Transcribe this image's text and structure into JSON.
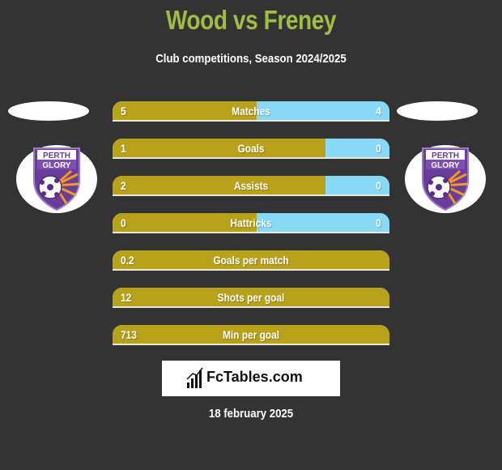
{
  "header": {
    "title": "Wood vs Freney",
    "subtitle": "Club competitions, Season 2024/2025"
  },
  "players": {
    "left": {
      "name": "Wood",
      "club_logo": "perth-glory-logo",
      "club_text": [
        "PERTH",
        "GLORY"
      ]
    },
    "right": {
      "name": "Freney",
      "club_logo": "perth-glory-logo",
      "club_text": [
        "PERTH",
        "GLORY"
      ]
    }
  },
  "colors": {
    "left": "#b8a21a",
    "right": "#87d9f5",
    "title": "#a0bc43",
    "background": "#333333"
  },
  "stats": [
    {
      "label": "Matches",
      "left": "5",
      "right": "4",
      "left_fill": 0.52
    },
    {
      "label": "Goals",
      "left": "1",
      "right": "0",
      "left_fill": 0.77
    },
    {
      "label": "Assists",
      "left": "2",
      "right": "0",
      "left_fill": 0.77
    },
    {
      "label": "Hattricks",
      "left": "0",
      "right": "0",
      "left_fill": 0.52
    },
    {
      "label": "Goals per match",
      "left": "0.2",
      "right": "",
      "left_fill": 1.0
    },
    {
      "label": "Shots per goal",
      "left": "12",
      "right": "",
      "left_fill": 1.0
    },
    {
      "label": "Min per goal",
      "left": "713",
      "right": "",
      "left_fill": 1.0
    }
  ],
  "brand": {
    "name": "FcTables.com",
    "icon": "bar-chart-icon"
  },
  "footer": {
    "date": "18 february 2025"
  }
}
